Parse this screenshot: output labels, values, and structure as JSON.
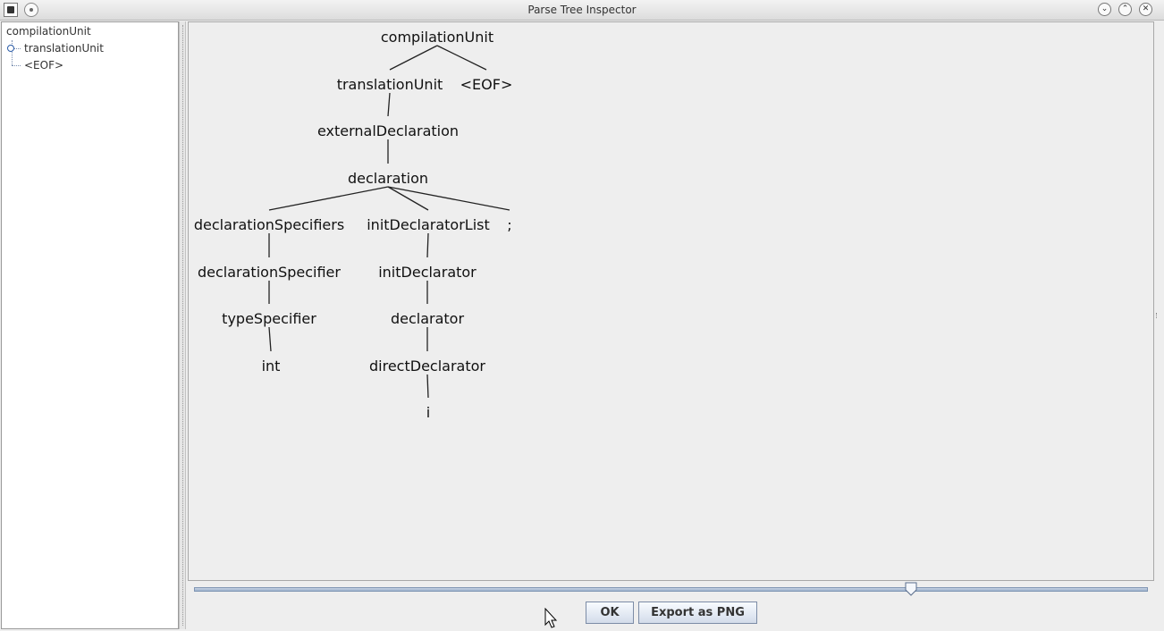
{
  "window": {
    "title": "Parse Tree Inspector",
    "controls": [
      "minimize-icon",
      "maximize-icon",
      "close-icon"
    ]
  },
  "tree_panel": {
    "root": "compilationUnit",
    "children": [
      "translationUnit",
      "<EOF>"
    ]
  },
  "parse_tree": {
    "nodes": [
      {
        "id": "compilationUnit",
        "label": "compilationUnit",
        "parent": null
      },
      {
        "id": "translationUnit",
        "label": "translationUnit",
        "parent": "compilationUnit"
      },
      {
        "id": "eof",
        "label": "<EOF>",
        "parent": "compilationUnit"
      },
      {
        "id": "externalDeclaration",
        "label": "externalDeclaration",
        "parent": "translationUnit"
      },
      {
        "id": "declaration",
        "label": "declaration",
        "parent": "externalDeclaration"
      },
      {
        "id": "declarationSpecifiers",
        "label": "declarationSpecifiers",
        "parent": "declaration"
      },
      {
        "id": "initDeclaratorList",
        "label": "initDeclaratorList",
        "parent": "declaration"
      },
      {
        "id": "semicolon",
        "label": ";",
        "parent": "declaration"
      },
      {
        "id": "declarationSpecifier",
        "label": "declarationSpecifier",
        "parent": "declarationSpecifiers"
      },
      {
        "id": "typeSpecifier",
        "label": "typeSpecifier",
        "parent": "declarationSpecifier"
      },
      {
        "id": "int",
        "label": "int",
        "parent": "typeSpecifier"
      },
      {
        "id": "initDeclarator",
        "label": "initDeclarator",
        "parent": "initDeclaratorList"
      },
      {
        "id": "declarator",
        "label": "declarator",
        "parent": "initDeclarator"
      },
      {
        "id": "directDeclarator",
        "label": "directDeclarator",
        "parent": "declarator"
      },
      {
        "id": "i",
        "label": "i",
        "parent": "directDeclarator"
      }
    ]
  },
  "zoom_slider": {
    "value": 0.75
  },
  "buttons": {
    "ok": "OK",
    "export": "Export as PNG"
  }
}
